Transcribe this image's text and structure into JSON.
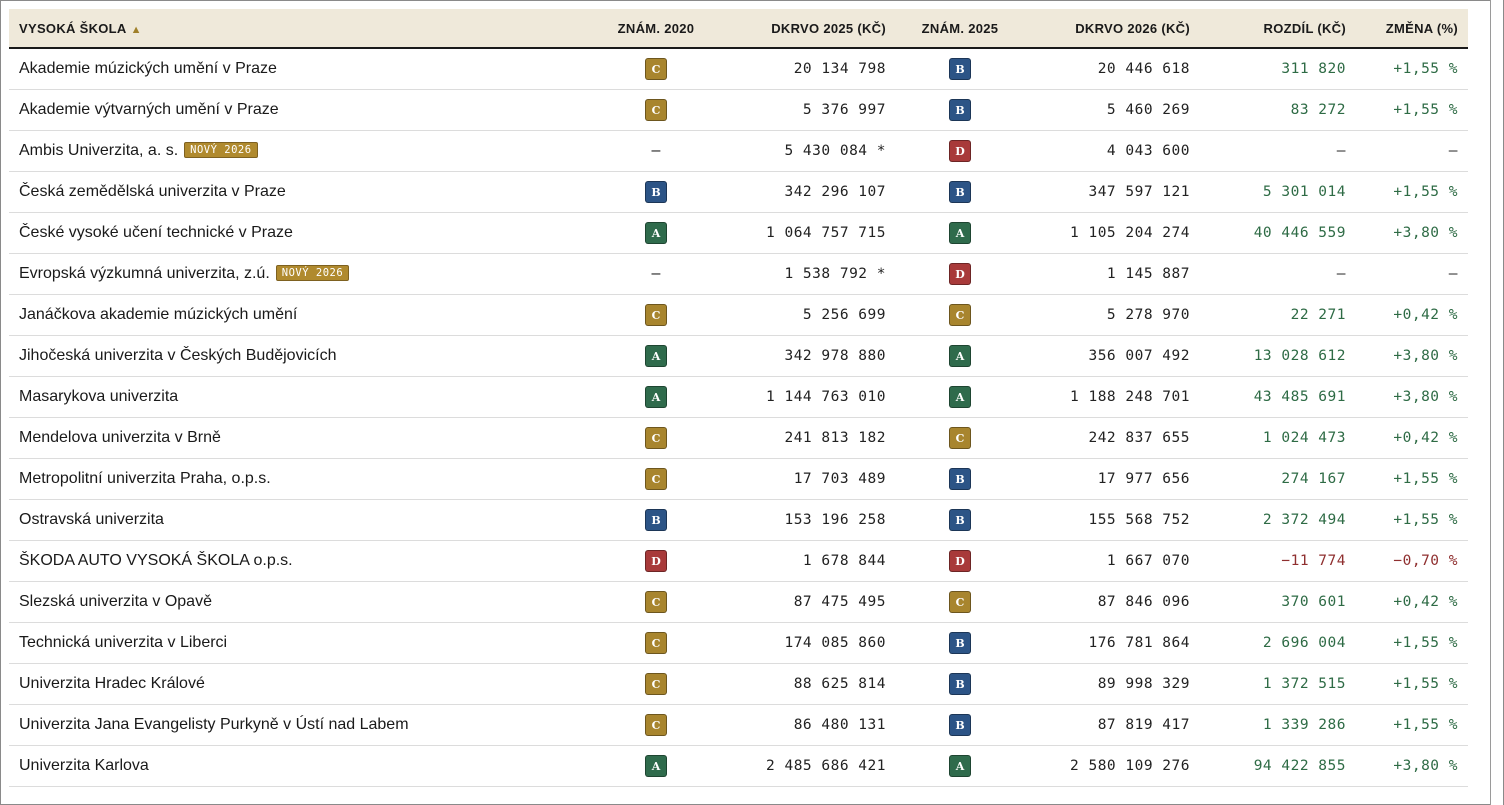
{
  "colors": {
    "grade_A": "#2f6b4c",
    "grade_B": "#2c5486",
    "grade_C": "#a8852e",
    "grade_D": "#a83a3a",
    "header_bg": "#efe9da",
    "positive": "#2e6b45",
    "negative": "#8f2f2f"
  },
  "header": {
    "school": "VYSOKÁ ŠKOLA",
    "sort_arrow": "▲",
    "grade_2020": "ZNÁM. 2020",
    "dkrvo_2025": "DKRVO 2025 (KČ)",
    "grade_2025": "ZNÁM. 2025",
    "dkrvo_2026": "DKRVO 2026 (KČ)",
    "diff": "ROZDÍL (KČ)",
    "change": "ZMĚNA (%)"
  },
  "new_badge": "NOVÝ 2026",
  "rows": [
    {
      "name": "Akademie múzických umění v Praze",
      "grade_2020": "C",
      "dkrvo_2025": "20 134 798",
      "grade_2025": "B",
      "dkrvo_2026": "20 446 618",
      "diff": "311 820",
      "change": "+1,55 %"
    },
    {
      "name": "Akademie výtvarných umění v Praze",
      "grade_2020": "C",
      "dkrvo_2025": "5 376 997",
      "grade_2025": "B",
      "dkrvo_2026": "5 460 269",
      "diff": "83 272",
      "change": "+1,55 %"
    },
    {
      "name": "Ambis Univerzita, a. s.",
      "new": true,
      "grade_2020": "–",
      "dkrvo_2025": "5 430 084 *",
      "grade_2025": "D",
      "dkrvo_2026": "4 043 600",
      "diff": "–",
      "change": "–"
    },
    {
      "name": "Česká zemědělská univerzita v Praze",
      "grade_2020": "B",
      "dkrvo_2025": "342 296 107",
      "grade_2025": "B",
      "dkrvo_2026": "347 597 121",
      "diff": "5 301 014",
      "change": "+1,55 %"
    },
    {
      "name": "České vysoké učení technické v Praze",
      "grade_2020": "A",
      "dkrvo_2025": "1 064 757 715",
      "grade_2025": "A",
      "dkrvo_2026": "1 105 204 274",
      "diff": "40 446 559",
      "change": "+3,80 %"
    },
    {
      "name": "Evropská výzkumná univerzita, z.ú.",
      "new": true,
      "grade_2020": "–",
      "dkrvo_2025": "1 538 792 *",
      "grade_2025": "D",
      "dkrvo_2026": "1 145 887",
      "diff": "–",
      "change": "–"
    },
    {
      "name": "Janáčkova akademie múzických umění",
      "grade_2020": "C",
      "dkrvo_2025": "5 256 699",
      "grade_2025": "C",
      "dkrvo_2026": "5 278 970",
      "diff": "22 271",
      "change": "+0,42 %"
    },
    {
      "name": "Jihočeská univerzita v Českých Budějovicích",
      "grade_2020": "A",
      "dkrvo_2025": "342 978 880",
      "grade_2025": "A",
      "dkrvo_2026": "356 007 492",
      "diff": "13 028 612",
      "change": "+3,80 %"
    },
    {
      "name": "Masarykova univerzita",
      "grade_2020": "A",
      "dkrvo_2025": "1 144 763 010",
      "grade_2025": "A",
      "dkrvo_2026": "1 188 248 701",
      "diff": "43 485 691",
      "change": "+3,80 %"
    },
    {
      "name": "Mendelova univerzita v Brně",
      "grade_2020": "C",
      "dkrvo_2025": "241 813 182",
      "grade_2025": "C",
      "dkrvo_2026": "242 837 655",
      "diff": "1 024 473",
      "change": "+0,42 %"
    },
    {
      "name": "Metropolitní univerzita Praha, o.p.s.",
      "grade_2020": "C",
      "dkrvo_2025": "17 703 489",
      "grade_2025": "B",
      "dkrvo_2026": "17 977 656",
      "diff": "274 167",
      "change": "+1,55 %"
    },
    {
      "name": "Ostravská univerzita",
      "grade_2020": "B",
      "dkrvo_2025": "153 196 258",
      "grade_2025": "B",
      "dkrvo_2026": "155 568 752",
      "diff": "2 372 494",
      "change": "+1,55 %"
    },
    {
      "name": "ŠKODA AUTO VYSOKÁ ŠKOLA o.p.s.",
      "grade_2020": "D",
      "dkrvo_2025": "1 678 844",
      "grade_2025": "D",
      "dkrvo_2026": "1 667 070",
      "diff": "−11 774",
      "change": "−0,70 %",
      "negative": true
    },
    {
      "name": "Slezská univerzita v Opavě",
      "grade_2020": "C",
      "dkrvo_2025": "87 475 495",
      "grade_2025": "C",
      "dkrvo_2026": "87 846 096",
      "diff": "370 601",
      "change": "+0,42 %"
    },
    {
      "name": "Technická univerzita v Liberci",
      "grade_2020": "C",
      "dkrvo_2025": "174 085 860",
      "grade_2025": "B",
      "dkrvo_2026": "176 781 864",
      "diff": "2 696 004",
      "change": "+1,55 %"
    },
    {
      "name": "Univerzita Hradec Králové",
      "grade_2020": "C",
      "dkrvo_2025": "88 625 814",
      "grade_2025": "B",
      "dkrvo_2026": "89 998 329",
      "diff": "1 372 515",
      "change": "+1,55 %"
    },
    {
      "name": "Univerzita Jana Evangelisty Purkyně v Ústí nad Labem",
      "grade_2020": "C",
      "dkrvo_2025": "86 480 131",
      "grade_2025": "B",
      "dkrvo_2026": "87 819 417",
      "diff": "1 339 286",
      "change": "+1,55 %"
    },
    {
      "name": "Univerzita Karlova",
      "grade_2020": "A",
      "dkrvo_2025": "2 485 686 421",
      "grade_2025": "A",
      "dkrvo_2026": "2 580 109 276",
      "diff": "94 422 855",
      "change": "+3,80 %"
    }
  ]
}
